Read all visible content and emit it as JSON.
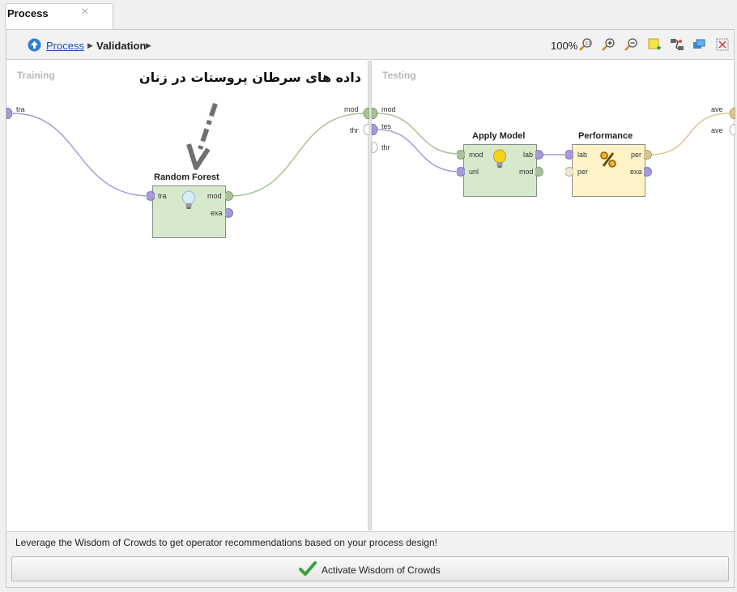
{
  "tab": {
    "title": "Process",
    "close_glyph": "×"
  },
  "breadcrumb": {
    "items": [
      "Process",
      "Validation"
    ],
    "arrow": "▶"
  },
  "toolbar": {
    "zoom": "100%",
    "icons": [
      "zoom-fit-icon",
      "zoom-in-icon",
      "zoom-out-icon",
      "add-note-icon",
      "auto-wire-icon",
      "arrange-icon",
      "fit-grid-icon"
    ]
  },
  "training": {
    "title": "Training",
    "left_ports": [
      "tra"
    ],
    "right_ports": [
      "mod",
      "thr"
    ],
    "annotation": "داده های سرطان پروستات در زنان",
    "operator": {
      "title": "Random Forest",
      "in_ports": [
        "tra"
      ],
      "out_ports": [
        "mod",
        "exa"
      ],
      "icon": "lightbulb-icon"
    }
  },
  "testing": {
    "title": "Testing",
    "left_ports": [
      "mod",
      "tes",
      "thr"
    ],
    "right_ports": [
      "ave",
      "ave"
    ],
    "apply_model": {
      "title": "Apply Model",
      "in_ports": [
        "mod",
        "unl"
      ],
      "out_ports": [
        "lab",
        "mod"
      ],
      "icon": "lightbulb-icon"
    },
    "performance": {
      "title": "Performance",
      "in_ports": [
        "lab",
        "per"
      ],
      "out_ports": [
        "per",
        "exa"
      ],
      "icon": "percent-icon"
    }
  },
  "woc": {
    "message": "Leverage the Wisdom of Crowds to get operator recommendations based on your process design!",
    "button_label": "Activate Wisdom of Crowds"
  },
  "colors": {
    "operator_green": "#d6e9cd",
    "operator_yellow": "#fdf3c7",
    "port_purple": "#a79ad9",
    "port_green": "#a9c399",
    "link_blue": "#1b4fb3",
    "check_green": "#3aa13a"
  }
}
